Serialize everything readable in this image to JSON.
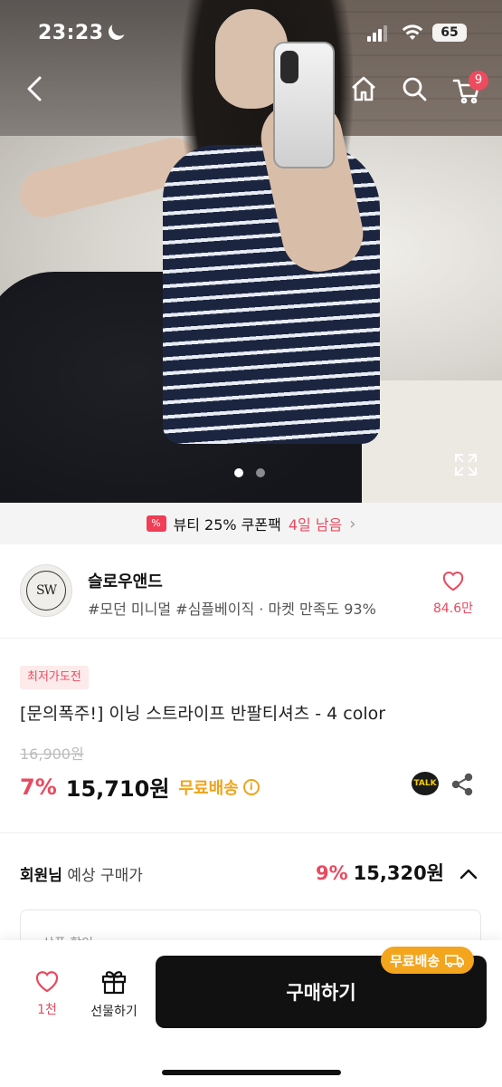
{
  "status_bar": {
    "time": "23:23",
    "battery": "65"
  },
  "cart": {
    "count": "9"
  },
  "gallery": {
    "pages": 2,
    "active": 1
  },
  "coupon_banner": {
    "text": "뷰티 25% 쿠폰팩",
    "days_left": "4일 남음",
    "tag_icon": "%"
  },
  "store": {
    "logo_text": "SW",
    "name": "슬로우앤드",
    "tags": "#모던 미니멀 #심플베이직 · 마켓 만족도 93%",
    "likes": "84.6만"
  },
  "product": {
    "badge": "최저가도전",
    "title": "[문의폭주!] 이닝 스트라이프 반팔티셔츠  - 4 color",
    "original_price": "16,900원",
    "discount": "7%",
    "price": "15,710원",
    "free_shipping": "무료배송",
    "talk_label": "TALK"
  },
  "member_price": {
    "label_bold": "회원님",
    "label_rest": " 예상 구매가",
    "discount": "9%",
    "price": "15,320원"
  },
  "detail_panel": {
    "label": "상품 할인"
  },
  "bottom_bar": {
    "like_count": "1천",
    "gift_label": "선물하기",
    "buy_label": "구매하기",
    "free_ship_tag": "무료배송"
  },
  "colors": {
    "accent_red": "#e84a5f",
    "shipping_orange": "#f0a31a",
    "buy_button": "#111111"
  }
}
